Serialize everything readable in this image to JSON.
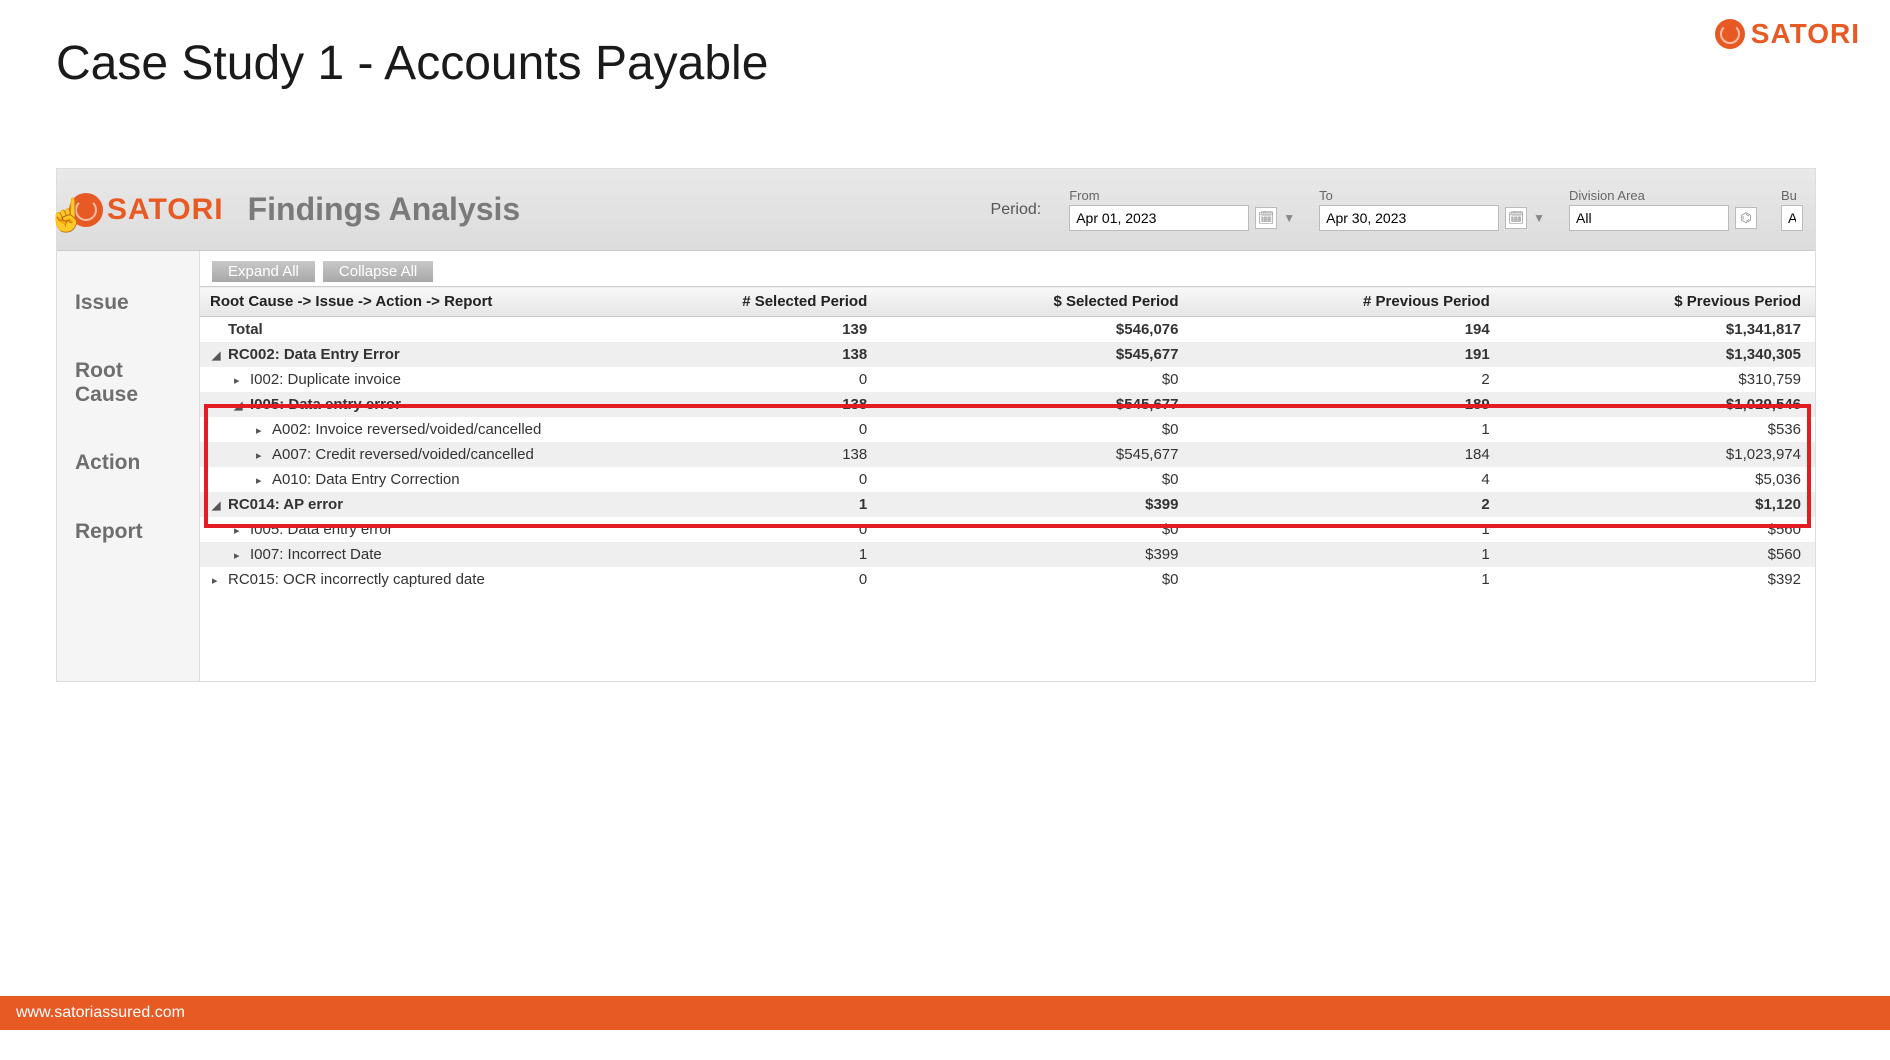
{
  "slide": {
    "title": "Case Study 1 - Accounts Payable",
    "brand": "SATORI",
    "footer_url": "www.satoriassured.com"
  },
  "app": {
    "brand": "SATORI",
    "page_title": "Findings Analysis",
    "filters": {
      "period_label": "Period:",
      "from_label": "From",
      "from_value": "Apr 01, 2023",
      "to_label": "To",
      "to_value": "Apr 30, 2023",
      "division_label": "Division Area",
      "division_value": "All",
      "bu_label": "Bu",
      "bu_value": "A"
    },
    "sidebar": [
      "Issue",
      "Root\nCause",
      "Action",
      "Report"
    ],
    "buttons": {
      "expand": "Expand All",
      "collapse": "Collapse All"
    },
    "headers": {
      "path": "Root Cause -> Issue -> Action -> Report",
      "c1": "# Selected Period",
      "c2": "$ Selected Period",
      "c3": "# Previous Period",
      "c4": "$ Previous Period"
    },
    "rows": [
      {
        "label": "Total",
        "c1": "139",
        "c2": "$546,076",
        "c3": "194",
        "c4": "$1,341,817",
        "cls": "total lvl0",
        "tri": ""
      },
      {
        "label": "RC002: Data Entry Error",
        "c1": "138",
        "c2": "$545,677",
        "c3": "191",
        "c4": "$1,340,305",
        "cls": "shade bold lvl0",
        "tri": "◢"
      },
      {
        "label": "I002: Duplicate invoice",
        "c1": "0",
        "c2": "$0",
        "c3": "2",
        "c4": "$310,759",
        "cls": "lvl1",
        "tri": "▸"
      },
      {
        "label": "I005: Data entry error",
        "c1": "138",
        "c2": "$545,677",
        "c3": "189",
        "c4": "$1,029,546",
        "cls": "shade bold lvl1",
        "tri": "◢"
      },
      {
        "label": "A002: Invoice reversed/voided/cancelled",
        "c1": "0",
        "c2": "$0",
        "c3": "1",
        "c4": "$536",
        "cls": "lvl2",
        "tri": "▸"
      },
      {
        "label": "A007: Credit reversed/voided/cancelled",
        "c1": "138",
        "c2": "$545,677",
        "c3": "184",
        "c4": "$1,023,974",
        "cls": "shade lvl2",
        "tri": "▸"
      },
      {
        "label": "A010: Data Entry Correction",
        "c1": "0",
        "c2": "$0",
        "c3": "4",
        "c4": "$5,036",
        "cls": "lvl2",
        "tri": "▸"
      },
      {
        "label": "RC014: AP error",
        "c1": "1",
        "c2": "$399",
        "c3": "2",
        "c4": "$1,120",
        "cls": "shade bold lvl0",
        "tri": "◢"
      },
      {
        "label": "I005: Data entry error",
        "c1": "0",
        "c2": "$0",
        "c3": "1",
        "c4": "$560",
        "cls": "lvl1",
        "tri": "▸"
      },
      {
        "label": "I007: Incorrect Date",
        "c1": "1",
        "c2": "$399",
        "c3": "1",
        "c4": "$560",
        "cls": "shade lvl1",
        "tri": "▸"
      },
      {
        "label": "RC015: OCR incorrectly captured date",
        "c1": "0",
        "c2": "$0",
        "c3": "1",
        "c4": "$392",
        "cls": "lvl0",
        "tri": "▸"
      }
    ]
  }
}
